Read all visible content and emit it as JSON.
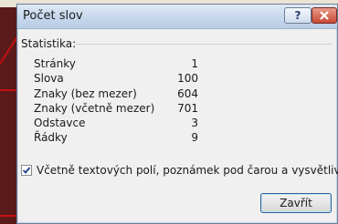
{
  "window": {
    "title": "Počet slov",
    "help_symbol": "?"
  },
  "group": {
    "label": "Statistika:"
  },
  "stats": [
    {
      "label": "Stránky",
      "value": "1"
    },
    {
      "label": "Slova",
      "value": "100"
    },
    {
      "label": "Znaky (bez mezer)",
      "value": "604"
    },
    {
      "label": "Znaky (včetně mezer)",
      "value": "701"
    },
    {
      "label": "Odstavce",
      "value": "3"
    },
    {
      "label": "Řádky",
      "value": "9"
    }
  ],
  "checkbox": {
    "label": "Včetně textových polí, poznámek pod čarou a vysvětlivek",
    "checked": true
  },
  "buttons": {
    "close_label": "Zavřít"
  },
  "colors": {
    "annotation_red": "#c41010",
    "close_red": "#c84a35"
  }
}
